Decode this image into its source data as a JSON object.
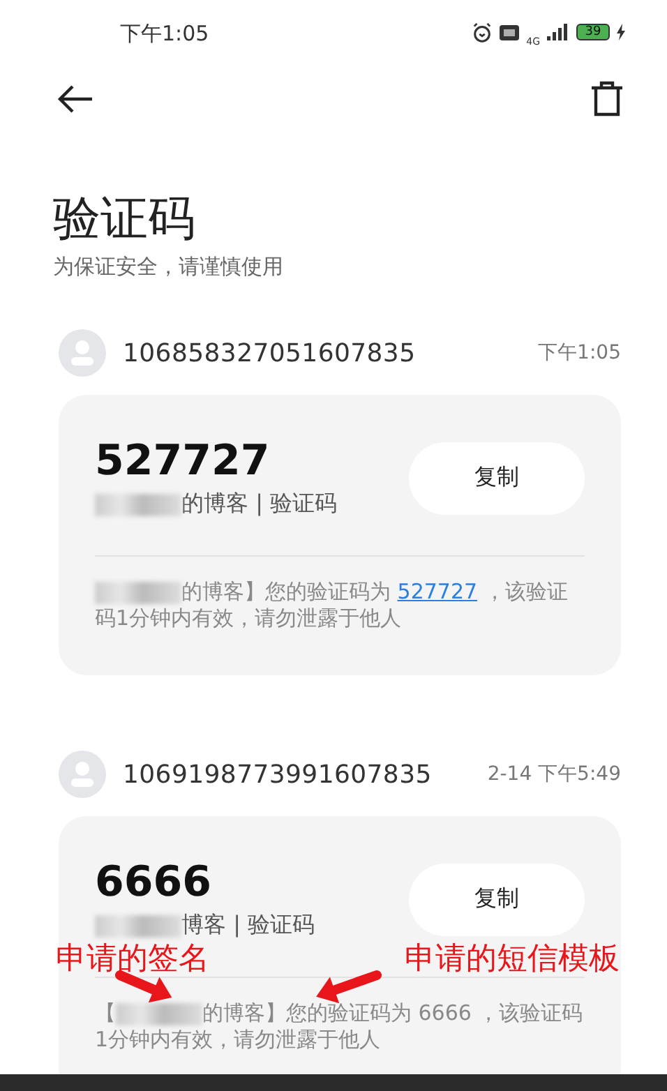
{
  "status_bar": {
    "time": "下午1:05",
    "network": "4G",
    "battery": "39"
  },
  "header": {
    "title": "验证码",
    "subtitle": "为保证安全，请谨慎使用"
  },
  "messages": [
    {
      "sender": "106858327051607835",
      "time": "下午1:05",
      "code": "527727",
      "source": [
        {
          "kind": "mask"
        },
        {
          "kind": "text",
          "text": "的博客 | 验证码"
        }
      ],
      "button": "复制",
      "body": [
        {
          "kind": "mask"
        },
        {
          "kind": "text",
          "text": "的博客】您的验证码为 "
        },
        {
          "kind": "link",
          "text": "527727"
        },
        {
          "kind": "text",
          "text": " ，该验证码1分钟内有效，请勿泄露于他人"
        }
      ]
    },
    {
      "sender": "1069198773991607835",
      "time": "2-14 下午5:49",
      "code": "6666",
      "source": [
        {
          "kind": "mask"
        },
        {
          "kind": "text",
          "text": "博客 | 验证码"
        }
      ],
      "button": "复制",
      "body": [
        {
          "kind": "text",
          "text": "【"
        },
        {
          "kind": "mask"
        },
        {
          "kind": "text",
          "text": "的博客】您的验证码为 6666 ，该验证码1分钟内有效，请勿泄露于他人"
        }
      ]
    }
  ],
  "annotations": [
    {
      "text": "申请的签名"
    },
    {
      "text": "申请的短信模板"
    }
  ]
}
